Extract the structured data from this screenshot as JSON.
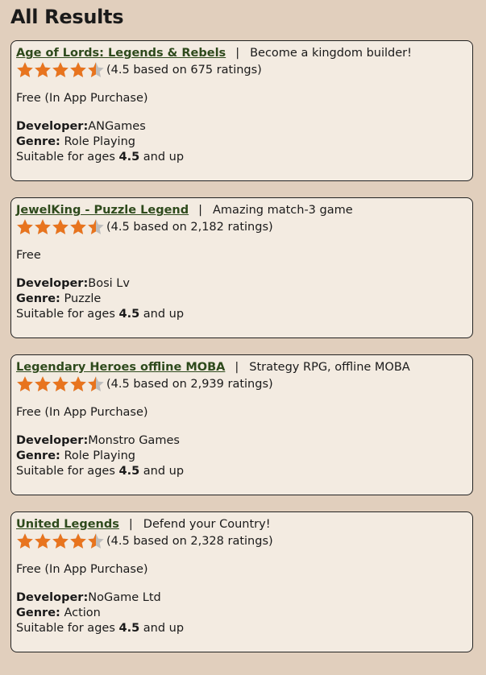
{
  "page": {
    "title": "All Results"
  },
  "labels": {
    "separator": "|",
    "developer": "Developer:",
    "genre": "Genre:",
    "ages_prefix": "Suitable for ages ",
    "ages_suffix": " and up"
  },
  "colors": {
    "background": "#e1cfbd",
    "card_background": "#f3ebe1",
    "link": "#2e4a1c",
    "star_filled": "#e8741e",
    "star_empty": "#bdbdbd"
  },
  "results": [
    {
      "name": "Age of Lords: Legends & Rebels",
      "tagline": "Become a kingdom builder!",
      "stars": 4.5,
      "rating_text": "(4.5 based on 675 ratings)",
      "price": "Free (In App Purchase)",
      "developer": "ANGames",
      "genre": "Role Playing",
      "age": "4.5"
    },
    {
      "name": "JewelKing - Puzzle Legend",
      "tagline": "Amazing match-3 game",
      "stars": 4.5,
      "rating_text": "(4.5 based on 2,182 ratings)",
      "price": "Free",
      "developer": "Bosi Lv",
      "genre": "Puzzle",
      "age": "4.5"
    },
    {
      "name": "Legendary Heroes offline MOBA",
      "tagline": "Strategy RPG, offline MOBA",
      "stars": 4.5,
      "rating_text": "(4.5 based on 2,939 ratings)",
      "price": "Free (In App Purchase)",
      "developer": "Monstro Games",
      "genre": "Role Playing",
      "age": "4.5"
    },
    {
      "name": "United Legends",
      "tagline": "Defend your Country!",
      "stars": 4.5,
      "rating_text": "(4.5 based on 2,328 ratings)",
      "price": "Free (In App Purchase)",
      "developer": "NoGame Ltd",
      "genre": "Action",
      "age": "4.5"
    }
  ]
}
